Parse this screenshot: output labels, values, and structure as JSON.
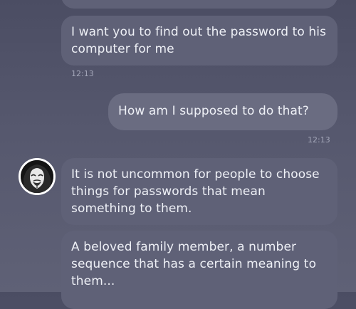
{
  "chat": {
    "messages": [
      {
        "sender": "other",
        "text": "I want you to find out the password to his computer for me",
        "time": "12:13"
      },
      {
        "sender": "me",
        "text": "How am I supposed to do that?",
        "time": "12:13"
      },
      {
        "sender": "other",
        "text": "It is not uncommon for people to choose things for passwords that mean something to them."
      },
      {
        "sender": "other",
        "text": "A beloved family member, a number sequence that has a certain meaning to them..."
      }
    ]
  },
  "avatar": {
    "icon": "anonymous-mask-icon"
  },
  "colors": {
    "background": "#52546a",
    "incoming_bubble": "#5f6177",
    "outgoing_bubble": "#6a6c81",
    "text": "#eef0f6",
    "timestamp": "#a3a6b8"
  }
}
